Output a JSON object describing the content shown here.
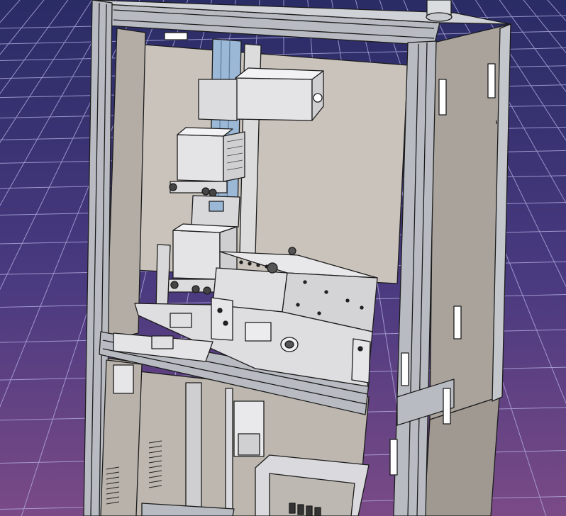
{
  "viewport": {
    "background": {
      "top_color": "#2a2c66",
      "mid_color": "#4a3a80",
      "bottom_color": "#7a4a86",
      "grid_color": "#b9b4e6"
    },
    "model": {
      "frame_color": "#b8bcc2",
      "frame_edge_color": "#1c1c1c",
      "panel_color": "#a9a39c",
      "interior_color": "#c9c3bb",
      "part_color": "#e4e4e6",
      "blue_rail_color": "#9bb8d6"
    }
  }
}
